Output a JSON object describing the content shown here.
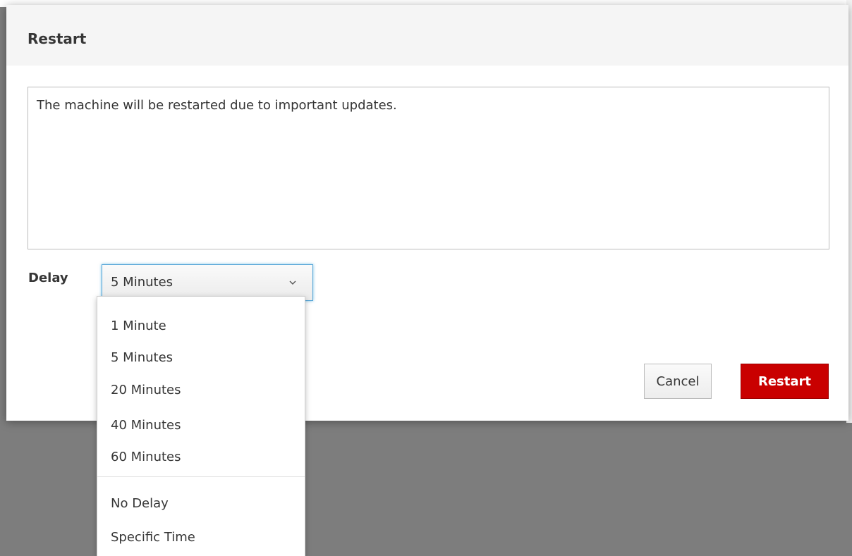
{
  "dialog": {
    "title": "Restart",
    "message": "The machine will be restarted due to important updates.",
    "delay_label": "Delay",
    "delay_selected": "5 Minutes",
    "delay_options": [
      "1 Minute",
      "5 Minutes",
      "20 Minutes",
      "40 Minutes",
      "60 Minutes"
    ],
    "delay_extra_options": [
      "No Delay",
      "Specific Time"
    ],
    "cancel_label": "Cancel",
    "confirm_label": "Restart"
  },
  "colors": {
    "danger": "#c90000",
    "focus": "#0088ce"
  },
  "icons": {
    "select_chevron": "chevron-down-icon"
  }
}
